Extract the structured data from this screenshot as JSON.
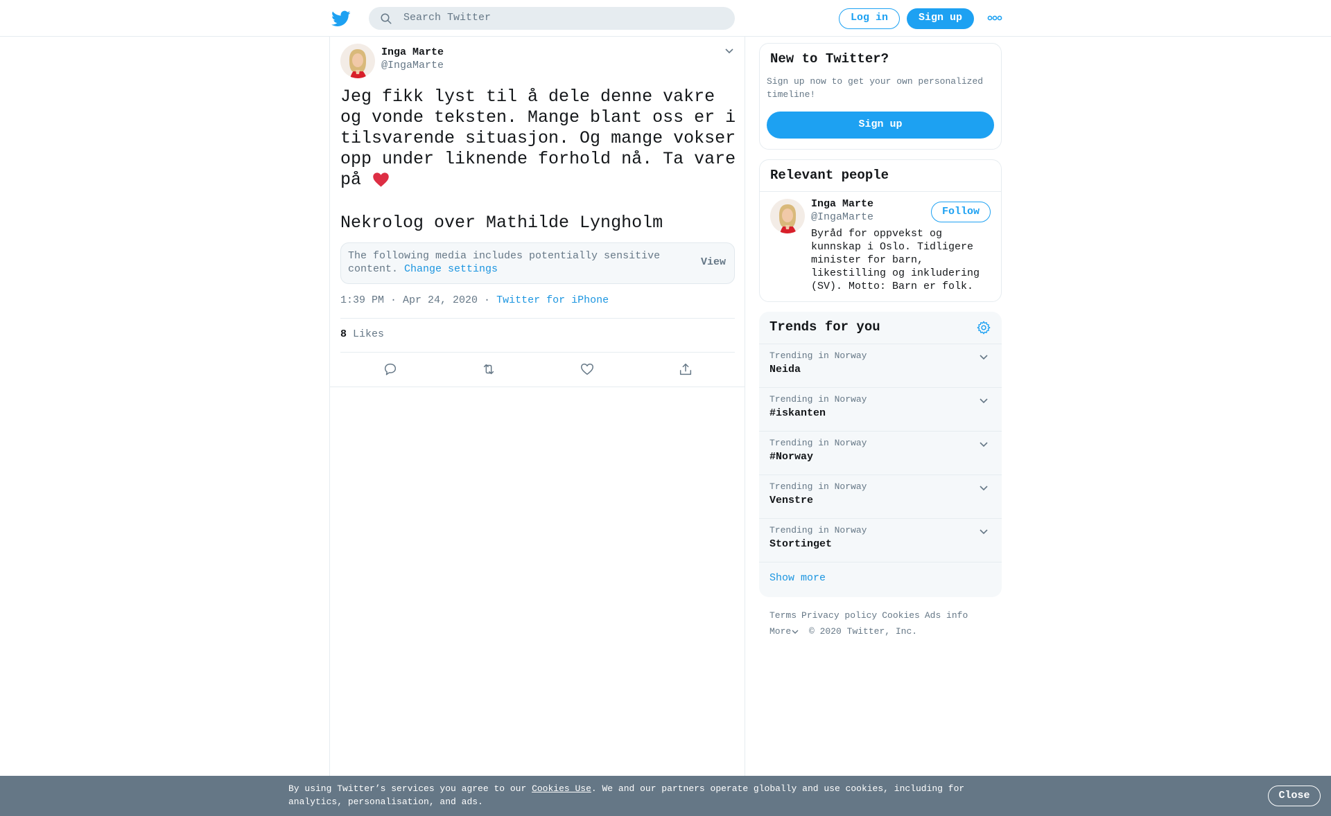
{
  "header": {
    "search_placeholder": "Search Twitter",
    "login_label": "Log in",
    "signup_label": "Sign up",
    "more_icon": "more-dots-icon"
  },
  "tweet": {
    "author_name": "Inga Marte",
    "author_handle": "@IngaMarte",
    "text": "Jeg fikk lyst til å dele denne vakre og vonde teksten. Mange blant oss er i tilsvarende situasjon. Og mange vokser opp under liknende forhold nå. Ta vare på ",
    "emoji": "red-heart-emoji",
    "link_title": "Nekrolog over Mathilde Lyngholm",
    "sensitive_message": "The following media includes potentially sensitive content. ",
    "change_settings_label": "Change settings",
    "view_label": "View",
    "timestamp": "1:39 PM · Apr 24, 2020",
    "meta_sep": " · ",
    "source": "Twitter for iPhone",
    "likes_count": "8",
    "likes_label": "Likes"
  },
  "new_to_twitter": {
    "title": "New to Twitter?",
    "description": "Sign up now to get your own personalized timeline!",
    "signup_label": "Sign up"
  },
  "relevant_people": {
    "title": "Relevant people",
    "name": "Inga Marte",
    "handle": "@IngaMarte",
    "follow_label": "Follow",
    "bio": "Byråd for oppvekst og kunnskap i Oslo. Tidligere minister for barn, likestilling og inkludering (SV). Motto: Barn er folk."
  },
  "trends": {
    "title": "Trends for you",
    "items": [
      {
        "context": "Trending in Norway",
        "name": "Neida"
      },
      {
        "context": "Trending in Norway",
        "name": "#iskanten"
      },
      {
        "context": "Trending in Norway",
        "name": "#Norway"
      },
      {
        "context": "Trending in Norway",
        "name": "Venstre"
      },
      {
        "context": "Trending in Norway",
        "name": "Stortinget"
      }
    ],
    "show_more_label": "Show more"
  },
  "footer": {
    "links": [
      "Terms",
      "Privacy policy",
      "Cookies",
      "Ads info"
    ],
    "more_label": "More",
    "copyright": "© 2020 Twitter, Inc."
  },
  "cookie_bar": {
    "text_before": "By using Twitter’s services you agree to our ",
    "link_label": "Cookies Use",
    "text_after": ". We and our partners operate globally and use cookies, including for analytics, personalisation, and ads.",
    "close_label": "Close"
  },
  "colors": {
    "accent": "#1da1f2",
    "link": "#1b95e0",
    "muted": "#657786",
    "cookie_bg": "#657786"
  }
}
